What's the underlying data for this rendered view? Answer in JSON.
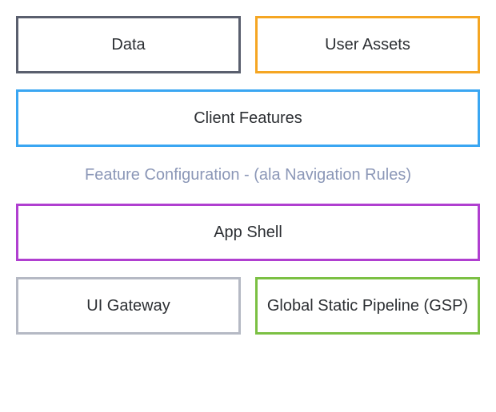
{
  "colors": {
    "data": "#5a5f6e",
    "user_assets": "#f5a623",
    "client_features": "#3aa6f2",
    "annotation_text": "#8b97b7",
    "app_shell": "#b03fd0",
    "ui_gateway": "#b5b9c4",
    "gsp": "#7bc043"
  },
  "boxes": {
    "data": "Data",
    "user_assets": "User Assets",
    "client_features": "Client Features",
    "app_shell": "App Shell",
    "ui_gateway": "UI Gateway",
    "gsp": "Global Static Pipeline (GSP)"
  },
  "annotation": "Feature Configuration - (ala Navigation Rules)"
}
